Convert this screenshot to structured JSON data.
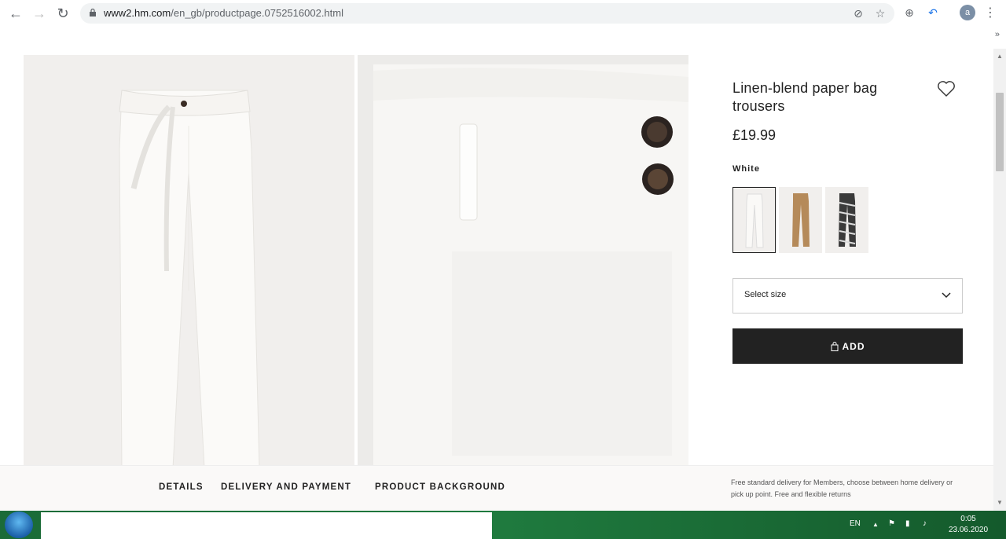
{
  "browser": {
    "url_host": "www2.hm.com",
    "url_path": "/en_gb/productpage.0752516002.html",
    "avatar_letter": "a",
    "icons": [
      "back-icon",
      "forward-icon",
      "reload-icon",
      "lock-icon",
      "translate-icon",
      "star-icon",
      "globe-icon",
      "undo-icon",
      "kebab-icon"
    ]
  },
  "product": {
    "title": "Linen-blend paper bag trousers",
    "price": "£19.99",
    "color_name": "White",
    "swatches": [
      {
        "name": "white",
        "color": "#f5f3f0",
        "selected": true
      },
      {
        "name": "beige",
        "color": "#b58a5a",
        "selected": false
      },
      {
        "name": "zebra",
        "color": "#3a3a3a",
        "selected": false
      }
    ],
    "size_placeholder": "Select size",
    "add_label": "ADD"
  },
  "tabs": {
    "details": "DETAILS",
    "delivery": "DELIVERY AND PAYMENT",
    "background": "PRODUCT BACKGROUND",
    "delivery_note": "Free standard delivery for Members, choose between home delivery or pick up point. Free and flexible returns"
  },
  "taskbar": {
    "lang": "EN",
    "time": "0:05",
    "date": "23.06.2020"
  },
  "colors": {
    "accent": "#222222",
    "taskbar": "#1f7a3e"
  }
}
